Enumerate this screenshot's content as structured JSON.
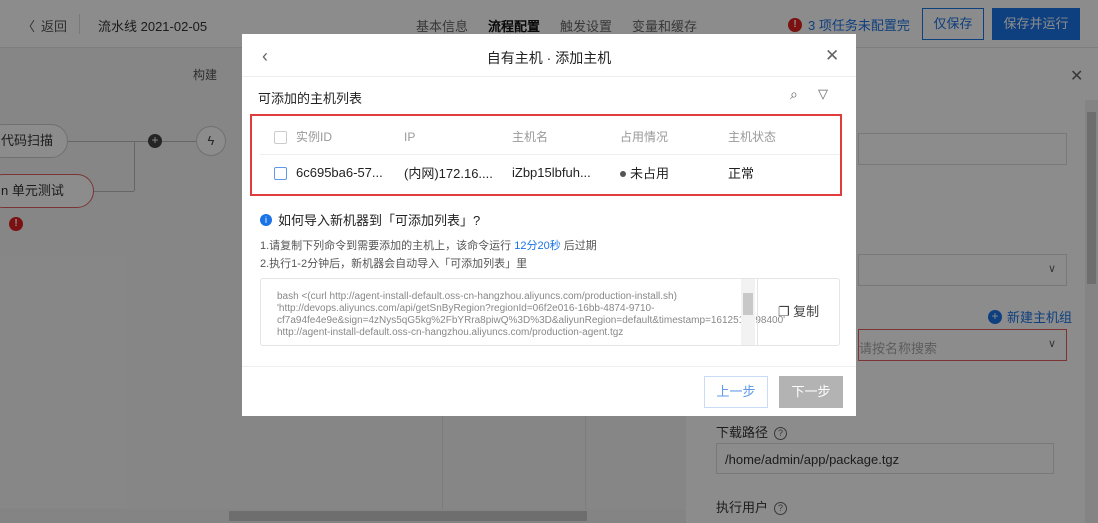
{
  "topbar": {
    "back_label": "返回",
    "pipeline_title": "流水线 2021-02-05",
    "tabs": [
      {
        "label": "基本信息",
        "active": false
      },
      {
        "label": "流程配置",
        "active": true
      },
      {
        "label": "触发设置",
        "active": false
      },
      {
        "label": "变量和缓存",
        "active": false
      }
    ],
    "warning_count_badge": "!",
    "warning_text": "3 项任务未配置完",
    "save_label": "仅保存",
    "save_run_label": "保存并运行"
  },
  "canvas": {
    "stage_label": "构建",
    "nodes": [
      {
        "label": "代码扫描"
      },
      {
        "label": "n 单元测试",
        "error_badge": "!"
      }
    ]
  },
  "right_panel": {
    "new_host_group_label": "新建主机组",
    "host_group_placeholder": "请按名称搜索",
    "download_path_label": "下载路径",
    "download_path_value": "/home/admin/app/package.tgz",
    "exec_user_label": "执行用户"
  },
  "modal": {
    "title": "自有主机 · 添加主机",
    "list_title": "可添加的主机列表",
    "columns": [
      "实例ID",
      "IP",
      "主机名",
      "占用情况",
      "主机状态"
    ],
    "rows": [
      {
        "instance_id": "6c695ba6-57...",
        "ip": "(内网)172.16....",
        "hostname": "iZbp15lbfuh...",
        "usage": "未占用",
        "status": "正常"
      }
    ],
    "import_title": "如何导入新机器到「可添加列表」?",
    "step1_prefix": "1.请复制下列命令到需要添加的主机上，该命令运行 ",
    "step1_time": "12分20秒",
    "step1_suffix": " 后过期",
    "step2": "2.执行1-2分钟后，新机器会自动导入「可添加列表」里",
    "command": "bash <(curl http://agent-install-default.oss-cn-hangzhou.aliyuncs.com/production-install.sh) 'http://devops.aliyuncs.com/api/getSnByRegion?regionId=06f2e016-16bb-4874-9710-cf7a94fe4e9e&sign=4zNys5qG5kg%2FbYRra8piwQ%3D%3D&aliyunRegion=default&timestamp=1612516698400' http://agent-install-default.oss-cn-hangzhou.aliyuncs.com/production-agent.tgz",
    "copy_label": "复制",
    "prev_label": "上一步",
    "next_label": "下一步"
  }
}
